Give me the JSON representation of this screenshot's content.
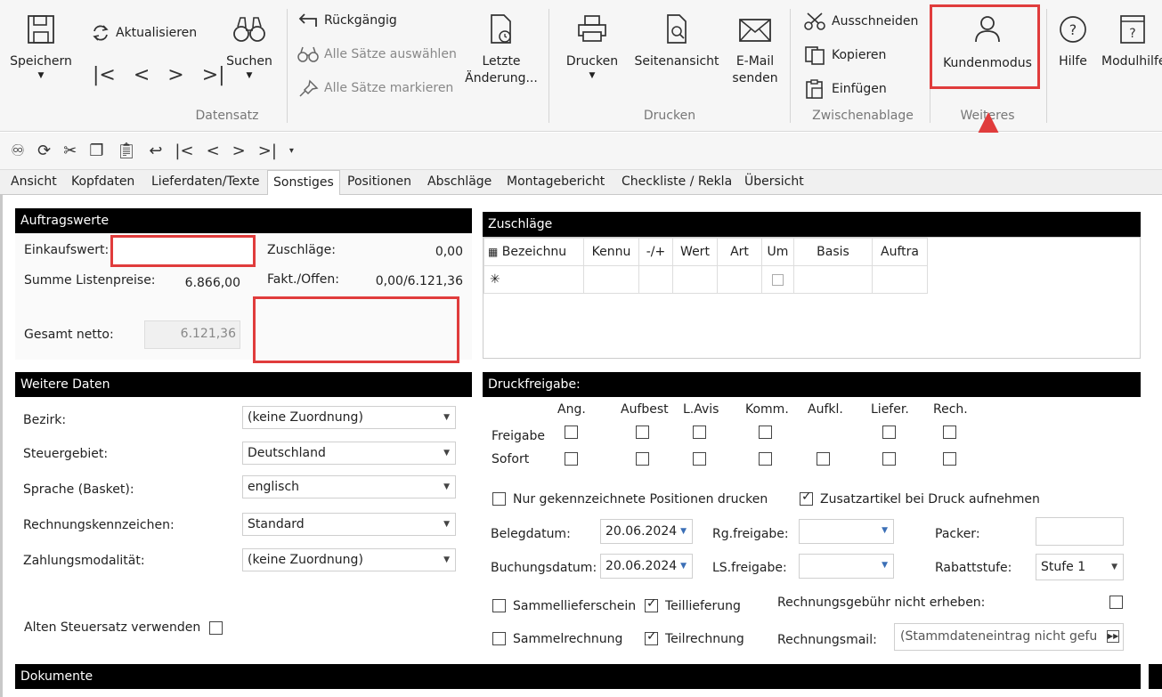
{
  "ribbon": {
    "datensatz": {
      "save": "Speichern",
      "refresh": "Aktualisieren",
      "search": "Suchen",
      "undo": "Rückgängig",
      "select_all": "Alle Sätze auswählen",
      "mark_all": "Alle Sätze markieren",
      "last_changes": "Letzte Änderung...",
      "group": "Datensatz"
    },
    "drucken": {
      "print": "Drucken",
      "preview": "Seitenansicht",
      "email_line1": "E-Mail",
      "email_line2": "senden",
      "group": "Drucken"
    },
    "zwischenablage": {
      "cut": "Ausschneiden",
      "copy": "Kopieren",
      "paste": "Einfügen",
      "group": "Zwischenablage"
    },
    "weiteres": {
      "customer_mode": "Kundenmodus",
      "group": "Weiteres"
    },
    "help": "Hilfe",
    "module_help": "Modulhilfe"
  },
  "tabs": [
    "Ansicht",
    "Kopfdaten",
    "Lieferdaten/Texte",
    "Sonstiges",
    "Positionen",
    "Abschläge",
    "Montagebericht",
    "Checkliste / Rekla",
    "Übersicht"
  ],
  "active_tab": "Sonstiges",
  "auftragswerte": {
    "title": "Auftragswerte",
    "einkaufswert_label": "Einkaufswert:",
    "einkaufswert_value": "",
    "summe_label": "Summe Listenpreise:",
    "summe_value": "6.866,00",
    "gesamt_label": "Gesamt netto:",
    "gesamt_value": "6.121,36",
    "zuschlaege_label": "Zuschläge:",
    "zuschlaege_value": "0,00",
    "fakt_label": "Fakt./Offen:",
    "fakt_value": "0,00/6.121,36"
  },
  "zuschlaege": {
    "title": "Zuschläge",
    "columns": [
      "Bezeichnu",
      "Kennu",
      "-/+",
      "Wert",
      "Art",
      "Um",
      "Basis",
      "Auftra"
    ],
    "new_row_marker": "✳"
  },
  "weitere": {
    "title": "Weitere Daten",
    "bezirk_label": "Bezirk:",
    "bezirk_value": "(keine Zuordnung)",
    "steuer_label": "Steuergebiet:",
    "steuer_value": "Deutschland",
    "sprache_label": "Sprache (Basket):",
    "sprache_value": "englisch",
    "rk_label": "Rechnungskennzeichen:",
    "rk_value": "Standard",
    "zm_label": "Zahlungsmodalität:",
    "zm_value": "(keine Zuordnung)",
    "alten_label": "Alten Steuersatz verwenden"
  },
  "druck": {
    "title": "Druckfreigabe:",
    "cols": [
      "Ang.",
      "Aufbest",
      "L.Avis",
      "Komm.",
      "Aufkl.",
      "Liefer.",
      "Rech."
    ],
    "row1": "Freigabe",
    "row2": "Sofort",
    "nur_label": "Nur gekennzeichnete Positionen drucken",
    "zusatz_label": "Zusatzartikel bei Druck aufnehmen",
    "beleg_label": "Belegdatum:",
    "beleg_value": "20.06.2024",
    "buch_label": "Buchungsdatum:",
    "buch_value": "20.06.2024",
    "rg_label": "Rg.freigabe:",
    "ls_label": "LS.freigabe:",
    "packer_label": "Packer:",
    "rabatt_label": "Rabattstufe:",
    "rabatt_value": "Stufe 1",
    "sammel_ls": "Sammellieferschein",
    "teil_lief": "Teillieferung",
    "sammel_re": "Sammelrechnung",
    "teil_re": "Teilrechnung",
    "gebuehr_label": "Rechnungsgebühr nicht erheben:",
    "mail_label": "Rechnungsmail:",
    "mail_value": "(Stammdateneintrag nicht gefu"
  },
  "dokumente": {
    "title": "Dokumente"
  }
}
